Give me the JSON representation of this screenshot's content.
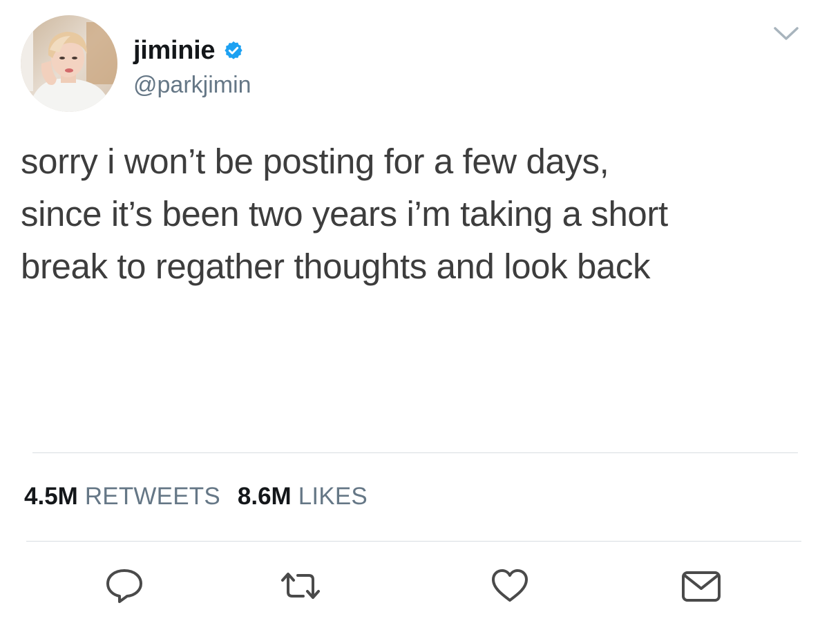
{
  "user": {
    "display_name": "jiminie",
    "handle": "@parkjimin",
    "verified": true
  },
  "tweet": {
    "lines": [
      "sorry i won’t be posting for a few days,",
      "since it’s been two years i’m taking a short",
      "break to regather thoughts and look back"
    ]
  },
  "stats": {
    "retweets_count": "4.5M",
    "retweets_label": "RETWEETS",
    "likes_count": "8.6M",
    "likes_label": "LIKES"
  },
  "icons": {
    "verified": "verified-badge-icon",
    "caret": "chevron-down-icon",
    "reply": "reply-icon",
    "retweet": "retweet-icon",
    "like": "heart-icon",
    "dm": "envelope-icon"
  },
  "colors": {
    "verified_blue": "#1da1f2",
    "secondary_text": "#657786",
    "icon_gray": "#4a4a4a",
    "divider": "#d8dde1"
  }
}
